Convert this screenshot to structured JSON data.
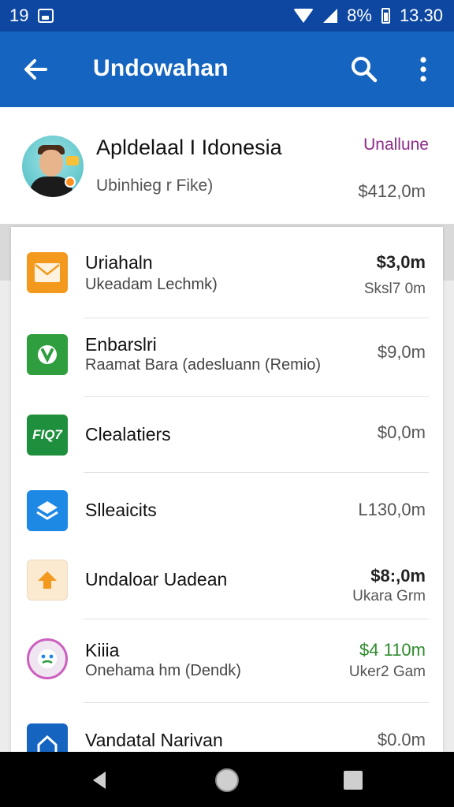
{
  "status_bar": {
    "left_text": "19",
    "battery_text": "8%",
    "time": "13.30"
  },
  "app_bar": {
    "title": "Undowahan"
  },
  "header": {
    "title": "Apldelaal I Idonesia",
    "subtitle": "Ubinhieg r Fike)",
    "status": "Unallune",
    "amount": "$412,0m"
  },
  "list": {
    "items": [
      {
        "title": "Uriahaln",
        "subtitle": "Ukeadam Lechmk)",
        "amount": "$3,0m",
        "subamount": "Sksl7 0m",
        "icon": "mail-icon",
        "icon_color": "#f39a1e"
      },
      {
        "title": "Enbarslri",
        "subtitle": "Raamat Bara (adesluann (Remio)",
        "amount": "$9,0m",
        "subamount": "",
        "icon": "vine-icon",
        "icon_color": "#2e9e3e"
      },
      {
        "title": "Clealatiers",
        "subtitle": "",
        "amount": "$0,0m",
        "subamount": "",
        "icon": "text-badge-icon",
        "icon_label": "FIQ7",
        "icon_color": "#1e8f3c"
      },
      {
        "title": "Slleaicits",
        "subtitle": "",
        "amount": "L130,0m",
        "subamount": "",
        "icon": "layers-icon",
        "icon_color": "#1e88e5"
      },
      {
        "title": "Undaloar Uadean",
        "subtitle": "",
        "amount": "$8:,0m",
        "subamount": "Ukara Grm",
        "icon": "arrow-icon",
        "icon_color": "#fbe9d0"
      },
      {
        "title": "Kiiia",
        "subtitle": "Onehama hm (Dendk)",
        "amount": "$4 110m",
        "subamount": "Uker2 Gam",
        "icon": "face-icon",
        "icon_color": "#e8e0ec"
      },
      {
        "title": "Vandatal Narivan",
        "subtitle": "",
        "amount": "$0.0m",
        "subamount": "",
        "icon": "home-icon",
        "icon_color": "#1565c0"
      }
    ]
  }
}
